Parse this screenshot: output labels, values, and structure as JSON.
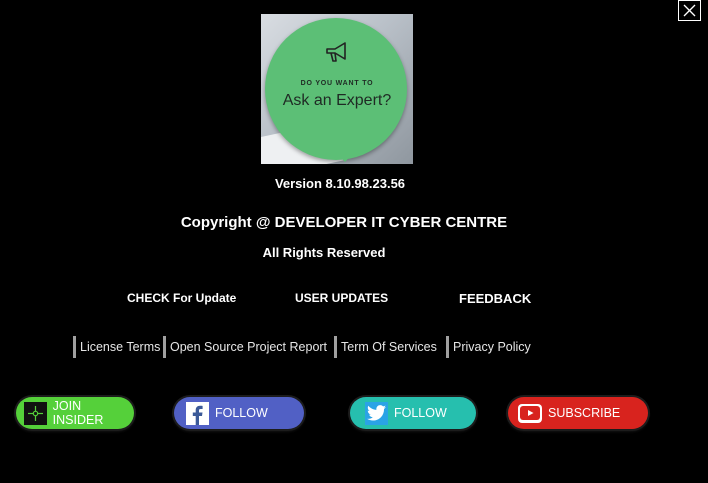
{
  "window": {
    "close_icon": "close-icon"
  },
  "logo": {
    "small_text": "DO YOU WANT TO",
    "big_text": "Ask an Expert?",
    "icon": "megaphone-icon",
    "bubble_color": "#5cbf76"
  },
  "version": "Version 8.10.98.23.56",
  "copyright": "Copyright @ DEVELOPER IT CYBER CENTRE",
  "rights": "All Rights Reserved",
  "actions": {
    "check_update": "CHECK For Update",
    "user_updates": "USER UPDATES",
    "feedback": "FEEDBACK"
  },
  "legal_links": {
    "license": "License Terms",
    "open_source": "Open Source Project Report",
    "terms": "Term Of Services",
    "privacy": "Privacy Policy"
  },
  "social": {
    "join": {
      "label": "JOIN INSIDER",
      "icon": "insider-icon",
      "color": "#55d03a"
    },
    "facebook": {
      "label": "FOLLOW",
      "icon": "facebook-icon",
      "color": "#5160c5"
    },
    "twitter": {
      "label": "FOLLOW",
      "icon": "twitter-icon",
      "color": "#26bfae"
    },
    "youtube": {
      "label": "SUBSCRIBE",
      "icon": "youtube-icon",
      "color": "#d8231e"
    }
  }
}
